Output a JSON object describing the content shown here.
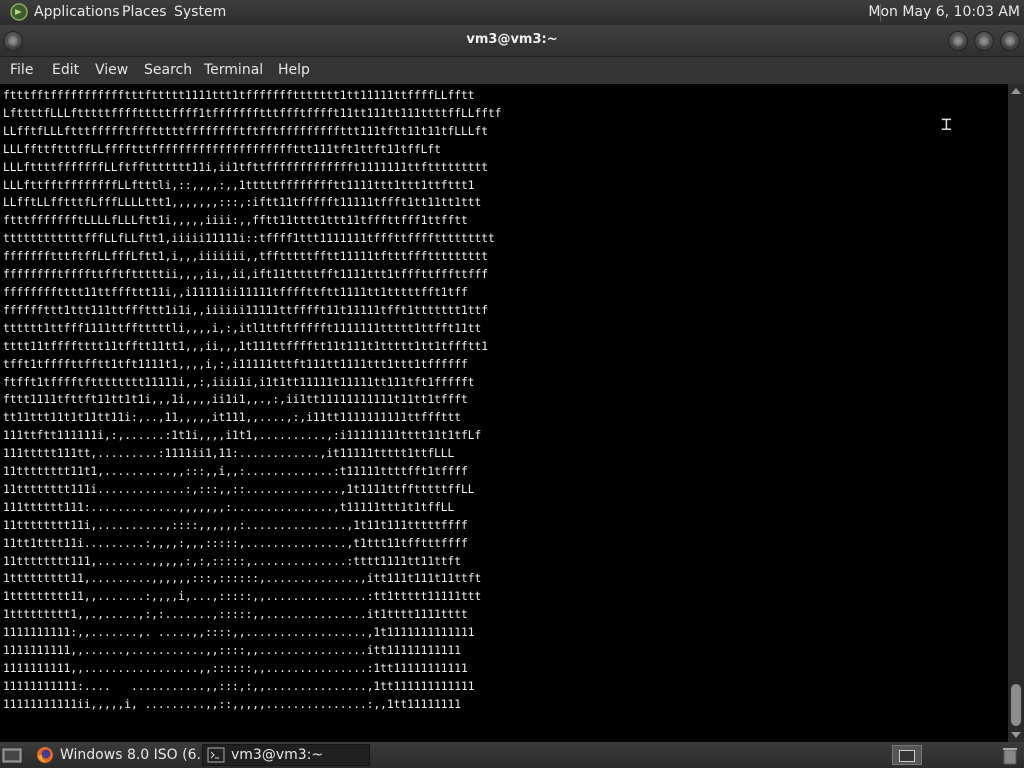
{
  "top_panel": {
    "menus": [
      "Applications",
      "Places",
      "System"
    ],
    "clock": "Mon May  6, 10:03 AM"
  },
  "window": {
    "title": "vm3@vm3:~",
    "menu": [
      "File",
      "Edit",
      "View",
      "Search",
      "Terminal",
      "Help"
    ]
  },
  "terminal": {
    "lines": [
      "ftttfftffffffffffftttfttttt1111ttt1tfffffffttttttt1tt11111ttffffLLfftt",
      "LfttttfLLLftttttfffftttttffff1tffffffftttffftfffft11tt111tt111ttttffLLfftf",
      "LLfftfLLLftttffffftffftttttfffffffftftfftfffffffffttt111tftt11t11tfLLLft",
      "LLLffttftttffLLfffftttfffffffffffffffffffffttt111tft1ttft11tffLft",
      "LLLfttttfffffffLLftffttttttt11i,ii1tfttffffffffffffft1111111ttfttttttttt",
      "LLLfttfftffffffffLLftttli,::,,,,:,,1tttttfffffffftt1111ttt1ttt1ttfttt1",
      "LLfftLLfftttfLfffLLLLttt1,,,,,,,:::,:iftt11tffffft11111tffft1tt11tt1ttt",
      "ftttffffffftLLLLfLLLftt1i,,,,,iiii:,,fftt11tttt1ttt11tfffttfff1ttfftt",
      "ttttttttttttfffLLfLLftt1,iiiii11111i::tffff1ttt1111111tfffttffffttttttttt",
      "ffffffftttftffLLfffLftt1,i,,,iiiiiii,,tfftttttfftt11111tftttfffttttttttt",
      "fffffffftffffttfftftttttii,,,,ii,,ii,ift11tttttfft1111ttt1tfffttfffttfff",
      "fffffffftttt11ttfffttt11i,,i11111ii11111tffffttftt1111tt1tttttfft1tff",
      "ffffffttt1ttt111ttfffttt1i1i,,iiiiii11111ttfffft11t11111tfft1ttttttt1ttf",
      "tttttt1ttfff1111ttfftttttli,,,,i,:,itl1ttftffffft1111111ttttt1ttfft11tt",
      "tttt11tfffftttt11tfftt11tt1,,,ii,,,1t111ttfffftt11t111t1ttttt1tt1tffftt1",
      "tfft1tffffttfftt1tft1111t1,,,,i,:,i11111tttft111tt1111ttt1ttt1tffffff",
      "ftfft1tfffftftttttttt11111i,,:,iiii1i,i1t1tt11111t11111tt111tft1ffffft",
      "fttt1111tfttft11tt1t1i,,,1i,,,,ii1i1,,.,:,ii1tt11111111111t11tt1tffft",
      "tt11ttt11t1t11tt11i:,..,11,,,,,it111,,....,:,i11tt1111111111ttfffttt",
      "111ttftt111111i,:,......:1t1i,,,,i1t1,..........,:i11111111tttt11t1tfLf",
      "111ttttt111tt,.........:1111ii1,11:............,it11111ttttt1ttfLLL",
      "11tttttttt11t1,..........,,:::,,i,,:.............:t11111ttttfft1tffff",
      "11tttttttt111i.............:,:::,,::..............,1t1111ttfftttttffLL",
      "111tttttt111:.............,,,,,,,:...............,t11111ttt1t1tffLL",
      "11tttttttt11i,..........,::::,,,,,,:...............,1t11t111tttttffff",
      "11tt1tttt11i.........:,,,,:,,,:::::,...............,t1ttt11tfftttffff",
      "11tttttttt111,........,,,,,:,:,:::::,..............:tttt1111tt11ttft",
      "1ttttttttt11,.........,,,,,,:::,::::::,..............,itt111t111t11ttft",
      "1ttttttttt11,,.......:,,,,i,...,:::::,,...............:tt1ttttt11111ttt",
      "1ttttttttt1,,.,.....,:,:.......,:::::,,...............it1tttt1111tttt",
      "1111111111:,,.......,. .....,,::::,,..................,1t1111111111111",
      "1111111111,,......,...........,,::::,,................itt11111111111",
      "1111111111,,.................,,::::::,,...............:1tt11111111111",
      "11111111111:....   ...........,,:::,:,,...............,1tt111111111111",
      "11111111111ii,,,,,i, .........,,::,,,,,...............:,,1tt11111111"
    ]
  },
  "taskbar": {
    "tasks": [
      "Windows 8.0 ISO (6...",
      "vm3@vm3:~"
    ]
  }
}
